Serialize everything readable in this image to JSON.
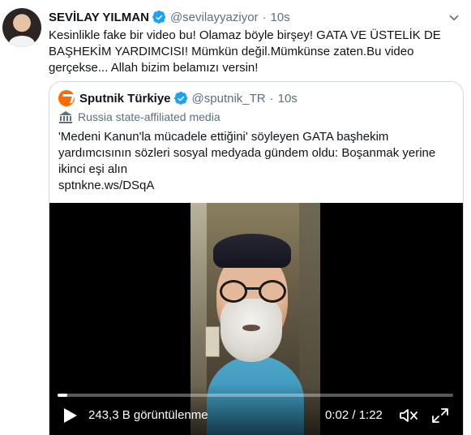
{
  "tweet": {
    "author_name": "SEVİLAY YILMAN",
    "author_handle": "@sevilayyaziyor",
    "separator": "·",
    "timestamp": "10s",
    "text": "Kesinlikle fake bir video bu! Olamaz böyle birşey! GATA VE ÜSTELİK DE BAŞHEKİM YARDIMCISI! Mümkün değil.Mümkünse zaten.Bu video gerçekse... Allah bizim belamızı versin!",
    "menu_icon": "chevron-down-icon",
    "verified_icon": "verified-badge-icon"
  },
  "quoted": {
    "author_name": "Sputnik Türkiye",
    "author_handle": "@sputnik_TR",
    "separator": "·",
    "timestamp": "10s",
    "affiliation": "Russia state-affiliated media",
    "affiliation_icon": "state-media-icon",
    "text_line1": "'Medeni Kanun'la mücadele ettiğini' söyleyen GATA başhekim",
    "text_line2": "yardımcısının sözleri sosyal medyada gündem oldu: Boşanmak yerine",
    "text_line3": "ikinci eşi alın",
    "link": "sptnkne.ws/DSqA"
  },
  "video": {
    "views": "243,3 B görüntülenme",
    "time": "0:02 / 1:22",
    "progress": 0.025,
    "play_icon": "play-icon",
    "mute_icon": "muted-volume-icon",
    "fullscreen_icon": "fullscreen-icon"
  },
  "colors": {
    "brand_blue": "#1da1f2",
    "muted_text": "#5b7083",
    "border": "#cfd9de",
    "sputnik_orange": "#ff6a00"
  }
}
